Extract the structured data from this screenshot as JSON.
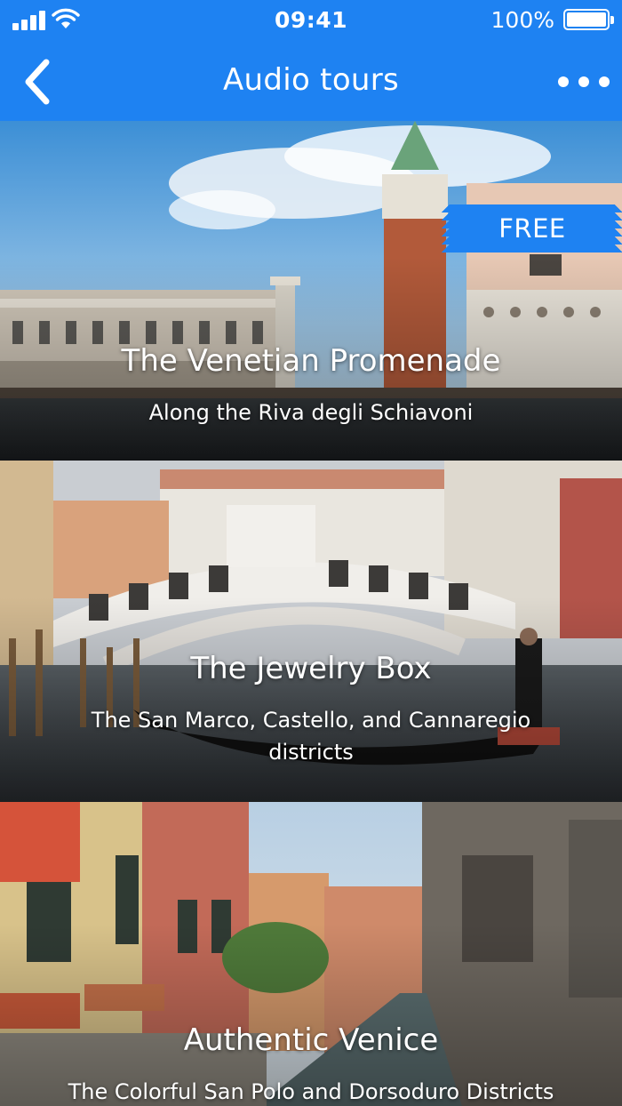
{
  "status_bar": {
    "time": "09:41",
    "battery": "100%"
  },
  "nav": {
    "title": "Audio tours",
    "back_icon": "chevron-left-icon",
    "more_icon": "ellipsis-icon"
  },
  "colors": {
    "accent": "#1e82f2"
  },
  "tours": [
    {
      "title": "The Venetian Promenade",
      "subtitle": "Along the Riva degli Schiavoni",
      "badge": "FREE"
    },
    {
      "title": "The Jewelry Box",
      "subtitle": "The San Marco, Castello, and Cannaregio districts"
    },
    {
      "title": "Authentic Venice",
      "subtitle": "The Colorful San Polo and Dorsoduro Districts"
    }
  ]
}
